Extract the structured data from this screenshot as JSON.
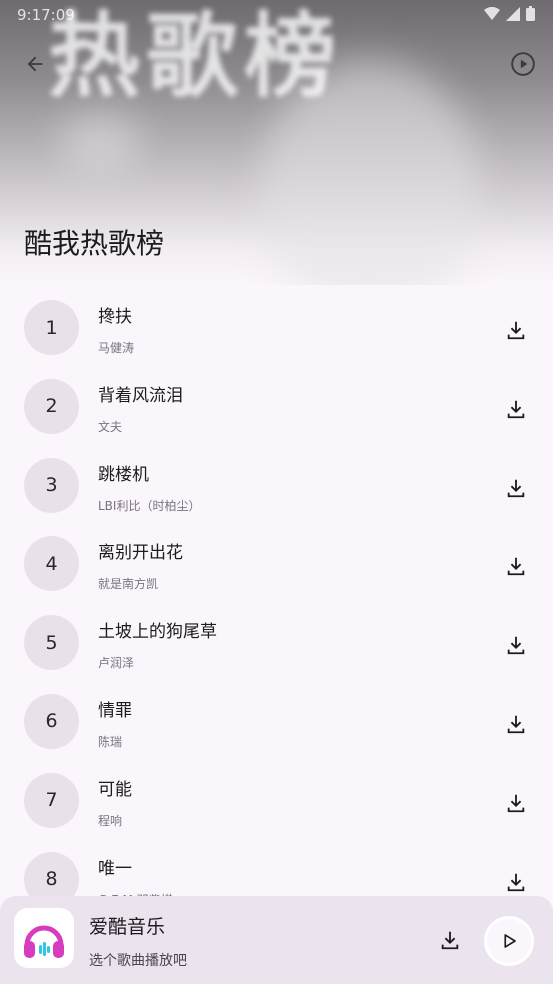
{
  "statusbar": {
    "time": "9:17:09"
  },
  "hero": {
    "banner_text": "热歌榜"
  },
  "page": {
    "title": "酷我热歌榜"
  },
  "songs": [
    {
      "rank": "1",
      "title": "搀扶",
      "artist": "马健涛"
    },
    {
      "rank": "2",
      "title": "背着风流泪",
      "artist": "文夫"
    },
    {
      "rank": "3",
      "title": "跳楼机",
      "artist": "LBI利比（时柏尘）"
    },
    {
      "rank": "4",
      "title": "离别开出花",
      "artist": "就是南方凯"
    },
    {
      "rank": "5",
      "title": "土坡上的狗尾草",
      "artist": "卢润泽"
    },
    {
      "rank": "6",
      "title": "情罪",
      "artist": "陈瑞"
    },
    {
      "rank": "7",
      "title": "可能",
      "artist": "程响"
    },
    {
      "rank": "8",
      "title": "唯一",
      "artist": "G.E.M.邓紫棋"
    }
  ],
  "player": {
    "app_name": "爱酷音乐",
    "subtitle": "选个歌曲播放吧"
  },
  "icons": {
    "back": "arrow-left-icon",
    "play_header": "play-circle-icon",
    "download": "download-icon",
    "play": "play-icon",
    "logo": "headphones-icon"
  },
  "colors": {
    "background": "#fbf6fb",
    "rank_circle": "#e9e1ea",
    "player_bar": "#ebe4ee",
    "logo_accent": "#d63cbd"
  }
}
